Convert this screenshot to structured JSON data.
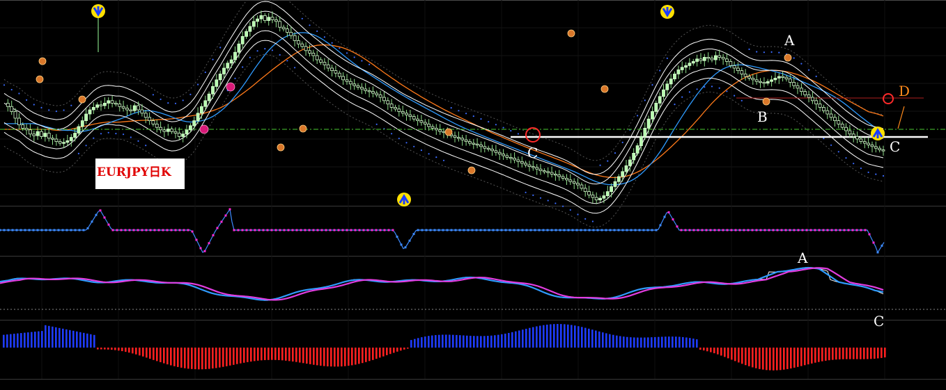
{
  "chart_title": "EURJPY日K",
  "annotations": {
    "main": [
      {
        "text": "A"
      },
      {
        "text": "B"
      },
      {
        "text": "C"
      },
      {
        "text": "C"
      },
      {
        "text": "D"
      }
    ],
    "osc": [
      {
        "text": "A"
      },
      {
        "text": "C"
      }
    ]
  },
  "colors": {
    "background": "#000000",
    "candle_up": "#b8ffb0",
    "candle_down": "#d8ffd0",
    "band_lines": "#ffffff",
    "dot_trail": "#3a6bff",
    "ma_blue": "#2f9bff",
    "ma_orange": "#ff7a1a",
    "level_line": "#3ea22a",
    "support_line": "#ffffff",
    "hist_pos": "#1f3cff",
    "hist_neg": "#ff2020",
    "step_blue": "#3d8bff",
    "step_magenta": "#ff2ad4",
    "osc_white": "#ffffff",
    "osc_blue": "#2f9bff",
    "osc_magenta": "#e23de0"
  },
  "chart_data": [
    {
      "type": "line",
      "name": "price",
      "close": [
        158,
        154,
        148,
        140,
        132,
        128,
        126,
        121,
        119,
        124,
        118,
        122,
        116,
        115,
        112,
        110,
        111,
        113,
        117,
        122,
        130,
        137,
        145,
        150,
        153,
        156,
        155,
        158,
        161,
        158,
        157,
        154,
        152,
        150,
        149,
        155,
        150,
        146,
        141,
        137,
        133,
        129,
        126,
        124,
        127,
        124,
        122,
        118,
        121,
        126,
        131,
        137,
        146,
        154,
        161,
        169,
        178,
        186,
        193,
        200,
        206,
        210,
        219,
        229,
        238,
        244,
        250,
        256,
        259,
        263,
        257,
        261,
        258,
        256,
        249,
        247,
        243,
        239,
        233,
        229,
        226,
        221,
        218,
        215,
        210,
        207,
        204,
        200,
        197,
        194,
        190,
        186,
        184,
        181,
        179,
        177,
        175,
        173,
        172,
        170,
        168,
        165,
        161,
        157,
        153,
        151,
        148,
        146,
        144,
        142,
        139,
        137,
        135,
        133,
        130,
        128,
        126,
        124,
        123,
        121,
        119,
        117,
        116,
        114,
        112,
        110,
        109,
        108,
        106,
        104,
        103,
        101,
        99,
        97,
        95,
        93,
        92,
        90,
        88,
        86,
        84,
        82,
        81,
        79,
        77,
        76,
        75,
        73,
        72,
        70,
        68,
        66,
        64,
        62,
        60,
        56,
        52,
        48,
        45,
        42,
        44,
        47,
        52,
        58,
        64,
        70,
        76,
        83,
        90,
        98,
        107,
        118,
        128,
        139,
        148,
        158,
        166,
        174,
        181,
        187,
        193,
        198,
        201,
        203,
        206,
        208,
        211,
        209,
        213,
        212,
        210,
        215,
        213,
        211,
        208,
        203,
        200,
        197,
        193,
        190,
        188,
        186,
        184,
        183,
        182,
        184,
        186,
        188,
        190,
        189,
        187,
        183,
        179,
        176,
        172,
        168,
        165,
        161,
        157,
        153,
        149,
        145,
        141,
        137,
        133,
        129,
        125,
        121,
        118,
        115,
        112,
        110,
        108,
        106,
        104,
        102,
        101
      ]
    },
    {
      "type": "line",
      "name": "ma_blue"
    },
    {
      "type": "line",
      "name": "ma_orange"
    },
    {
      "type": "line",
      "name": "step"
    },
    {
      "type": "line",
      "name": "oscillator"
    },
    {
      "type": "bar",
      "name": "histogram"
    }
  ]
}
